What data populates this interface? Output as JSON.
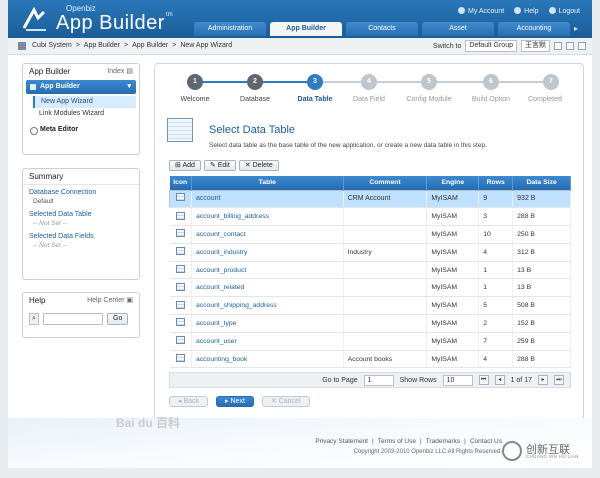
{
  "header": {
    "brand_small": "Openbiz",
    "brand_big": "App Builder",
    "brand_tm": "tm",
    "links": [
      "My Account",
      "Help",
      "Logout"
    ],
    "tabs": [
      {
        "label": "Administration",
        "active": false
      },
      {
        "label": "App Builder",
        "active": true
      },
      {
        "label": "Contacts",
        "active": false
      },
      {
        "label": "Asset",
        "active": false
      },
      {
        "label": "Accounting",
        "active": false
      }
    ]
  },
  "breadcrumb": {
    "items": [
      "Cubi System",
      "App Builder",
      "App Builder",
      "New App Wizard"
    ],
    "separator": ">",
    "switch_label": "Switch to",
    "group_value": "Default Group",
    "user_value": "王言默"
  },
  "sidebar": {
    "title": "App Builder",
    "index_label": "Index",
    "section": "App Builder",
    "items": [
      "New App Wizard",
      "Link Modules Wizard"
    ],
    "meta": "Meta Editor"
  },
  "summary": {
    "title": "Summary",
    "sections": [
      {
        "label": "Database Connection",
        "value": "Default",
        "notset": false
      },
      {
        "label": "Selected Data Table",
        "value": "-- Not Set --",
        "notset": true
      },
      {
        "label": "Selected Data Fields",
        "value": "-- Not Set --",
        "notset": true
      }
    ]
  },
  "help": {
    "title": "Help",
    "center_label": "Help Center",
    "go_label": "Go"
  },
  "wizard": {
    "steps": [
      {
        "num": "1",
        "label": "Welcome",
        "state": "done"
      },
      {
        "num": "2",
        "label": "Database",
        "state": "done"
      },
      {
        "num": "3",
        "label": "Data Table",
        "state": "active"
      },
      {
        "num": "4",
        "label": "Data Field",
        "state": "todo"
      },
      {
        "num": "5",
        "label": "Config Module",
        "state": "todo"
      },
      {
        "num": "6",
        "label": "Build Option",
        "state": "todo"
      },
      {
        "num": "7",
        "label": "Completed",
        "state": "todo"
      }
    ]
  },
  "page": {
    "title": "Select Data Table",
    "description": "Select data table as the base table of the new application, or create a new data table in this step."
  },
  "toolbar": {
    "add_label": "Add",
    "edit_label": "Edit",
    "delete_label": "Delete"
  },
  "table": {
    "columns": [
      "Icon",
      "Table",
      "Comment",
      "Engine",
      "Rows",
      "Data Size"
    ],
    "rows": [
      {
        "table": "account",
        "comment": "CRM Account",
        "engine": "MyISAM",
        "rows": "9",
        "size": "932 B",
        "selected": true
      },
      {
        "table": "account_billing_address",
        "comment": "",
        "engine": "MyISAM",
        "rows": "3",
        "size": "288 B",
        "selected": false
      },
      {
        "table": "account_contact",
        "comment": "",
        "engine": "MyISAM",
        "rows": "10",
        "size": "250 B",
        "selected": false
      },
      {
        "table": "account_industry",
        "comment": "Industry",
        "engine": "MyISAM",
        "rows": "4",
        "size": "312 B",
        "selected": false
      },
      {
        "table": "account_product",
        "comment": "",
        "engine": "MyISAM",
        "rows": "1",
        "size": "13 B",
        "selected": false
      },
      {
        "table": "account_related",
        "comment": "",
        "engine": "MyISAM",
        "rows": "1",
        "size": "13 B",
        "selected": false
      },
      {
        "table": "account_shipping_address",
        "comment": "",
        "engine": "MyISAM",
        "rows": "5",
        "size": "508 B",
        "selected": false
      },
      {
        "table": "account_type",
        "comment": "",
        "engine": "MyISAM",
        "rows": "2",
        "size": "152 B",
        "selected": false
      },
      {
        "table": "account_user",
        "comment": "",
        "engine": "MyISAM",
        "rows": "7",
        "size": "259 B",
        "selected": false
      },
      {
        "table": "accounting_book",
        "comment": "Account books",
        "engine": "MyISAM",
        "rows": "4",
        "size": "288 B",
        "selected": false
      }
    ]
  },
  "pager": {
    "goto_label": "Go to Page",
    "page_value": "1",
    "show_rows_label": "Show Rows",
    "rows_value": "10",
    "page_info": "1 of 17"
  },
  "nav": {
    "back_label": "Back",
    "next_label": "Next",
    "cancel_label": "Cancel"
  },
  "footer": {
    "links": [
      "Privacy Statement",
      "Terms of Use",
      "Trademarks",
      "Contact Us"
    ],
    "copyright": "Copyright 2003-2010 Openbiz LLC All Rights Reserved."
  },
  "watermarks": {
    "baidu": "Bai du 百科",
    "brand_cn": "创新互联",
    "brand_en": "CHUANG XIN HU LIAN"
  },
  "colors": {
    "header_blue": "#1a5d99",
    "accent_blue": "#2f7cc3",
    "selected_row": "#bfe1ff"
  }
}
